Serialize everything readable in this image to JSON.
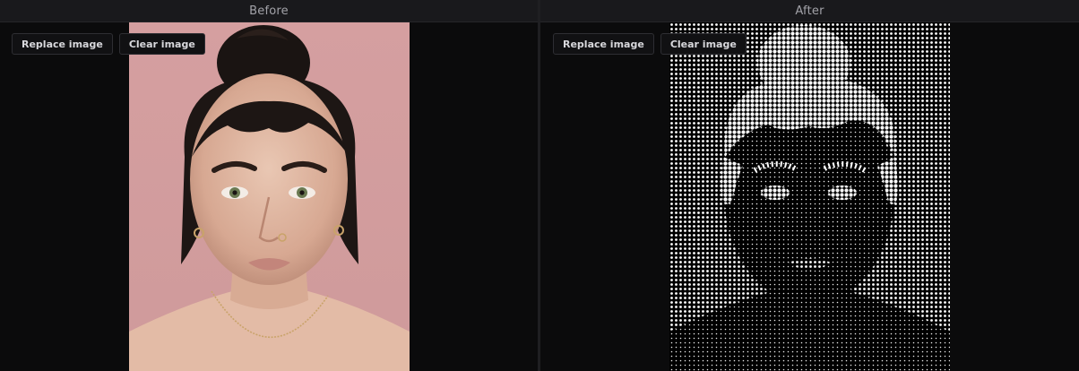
{
  "panes": {
    "before": {
      "title": "Before",
      "replace_label": "Replace image",
      "clear_label": "Clear image"
    },
    "after": {
      "title": "After",
      "replace_label": "Replace image",
      "clear_label": "Clear image"
    }
  },
  "colors": {
    "background": "#0b0b0c",
    "header": "#19191c",
    "portrait_bg": "#d19a9b",
    "halftone_dot": "#ffffff"
  }
}
